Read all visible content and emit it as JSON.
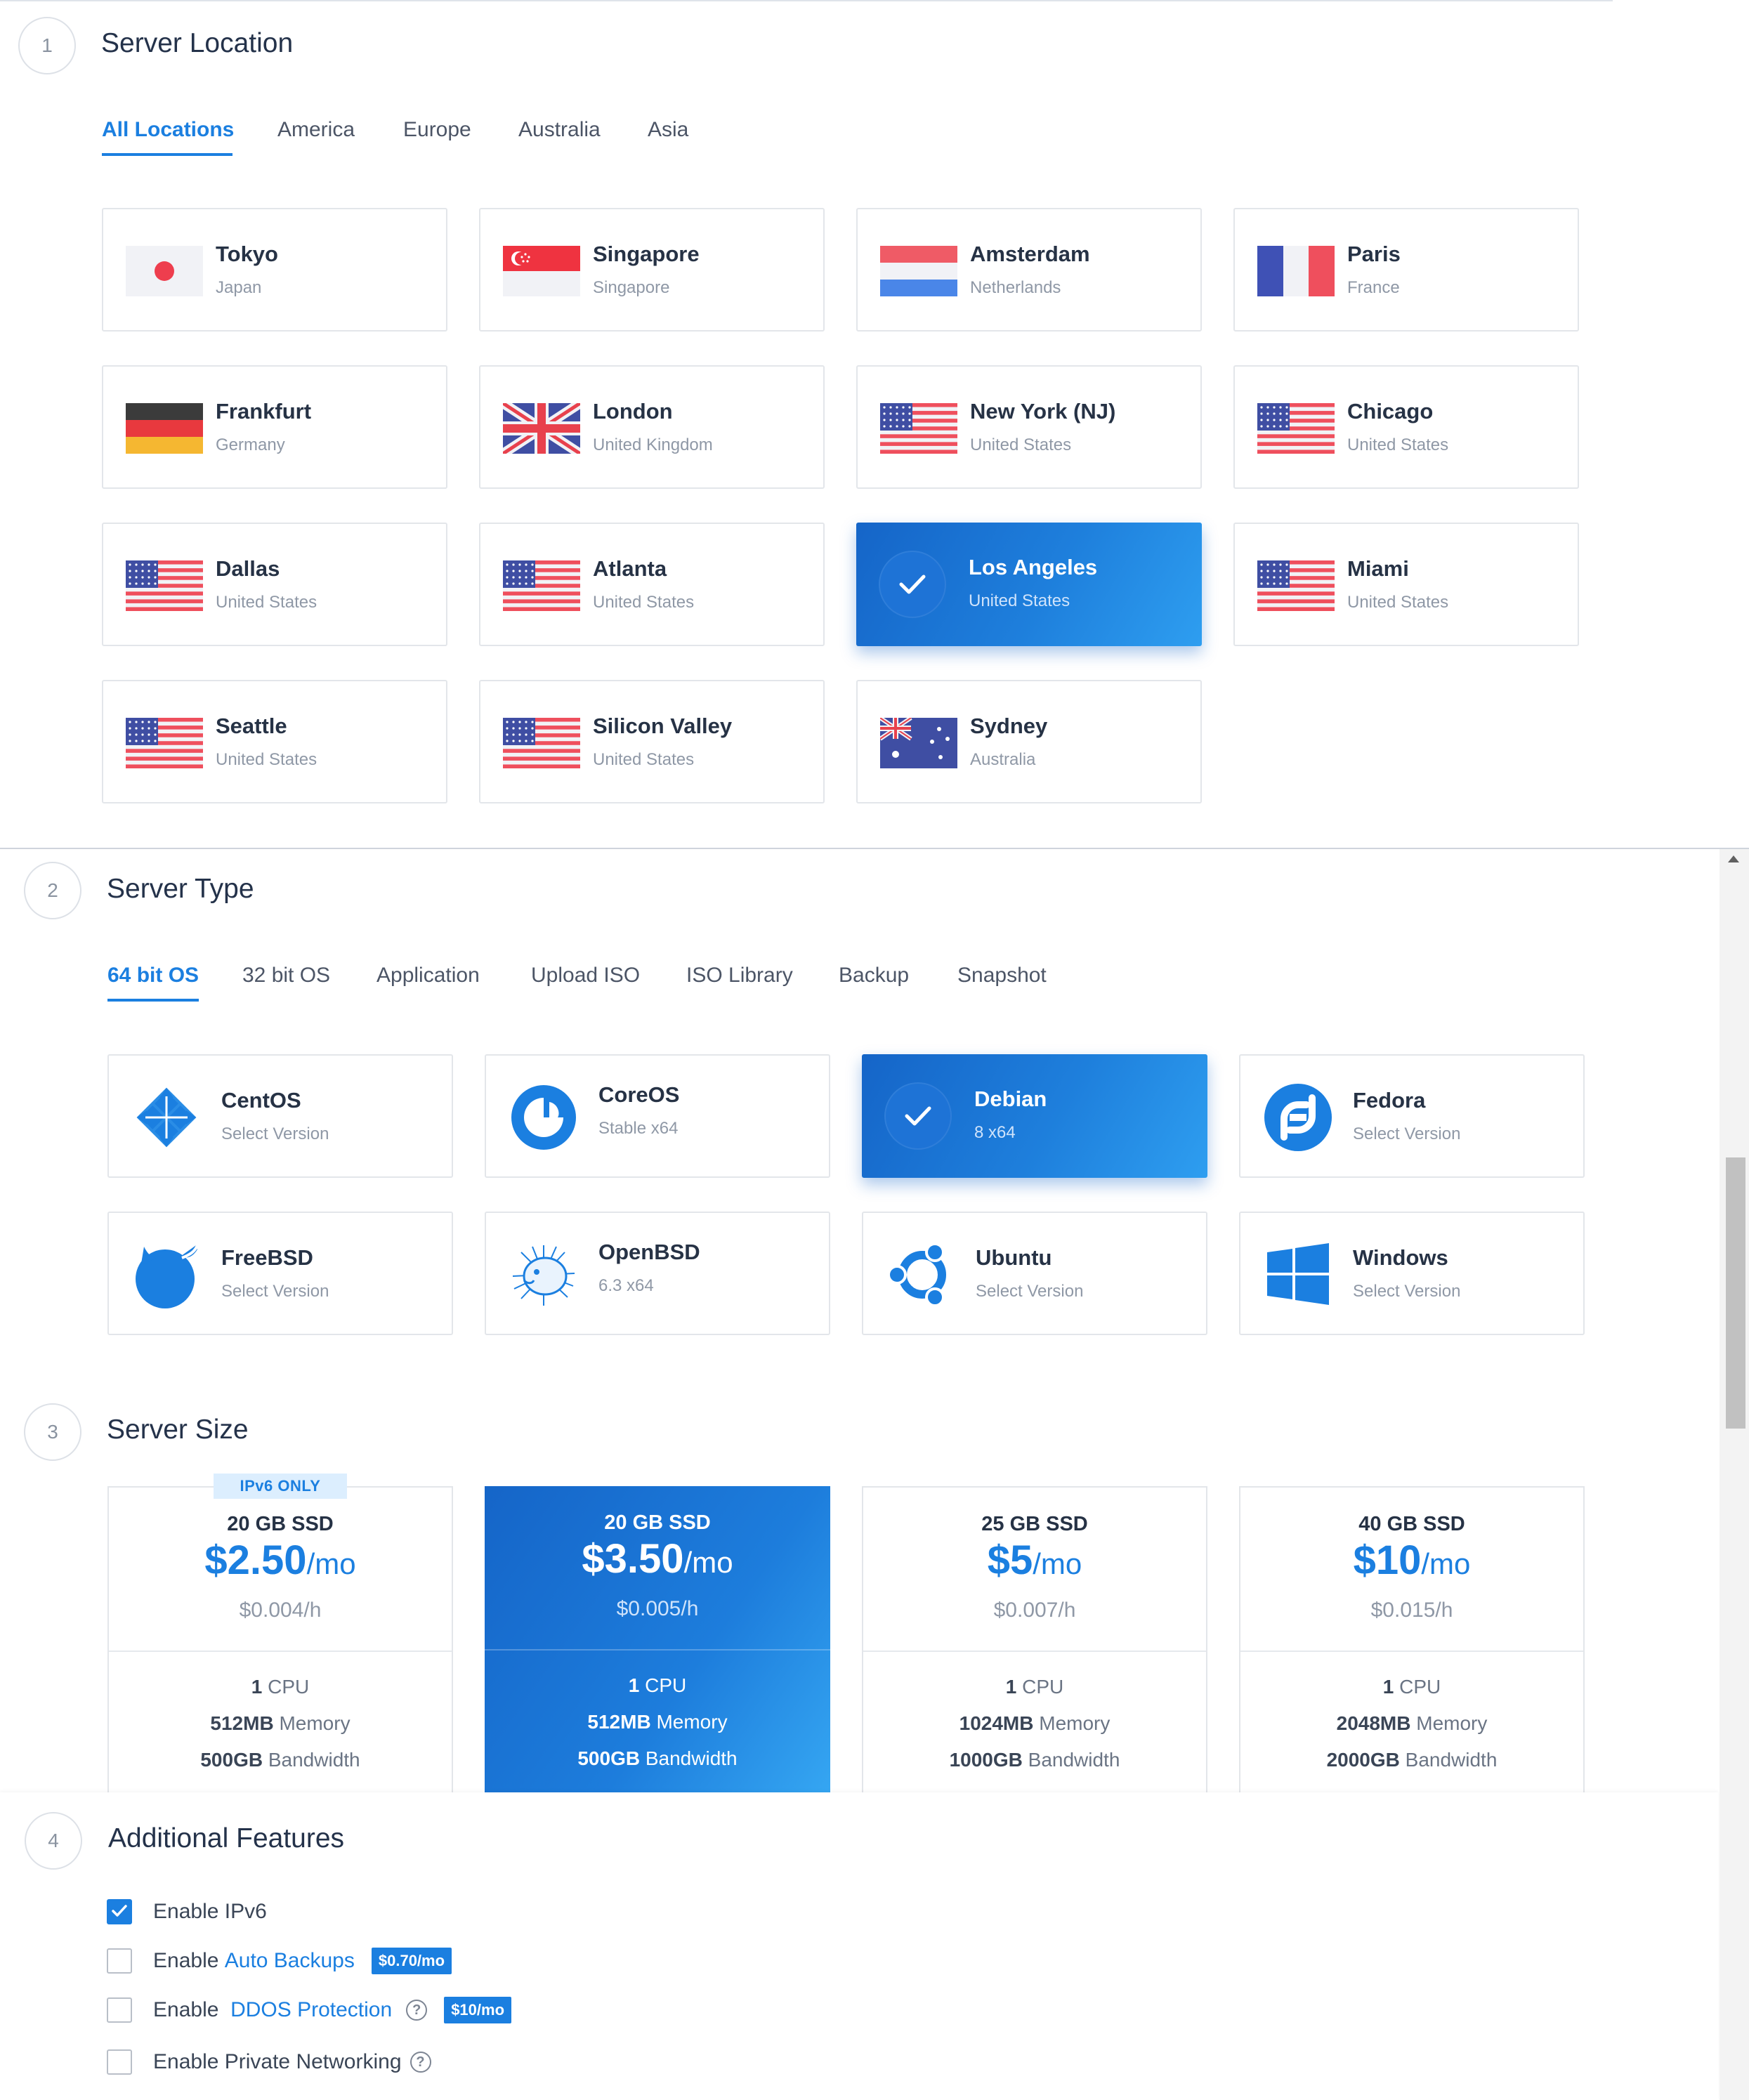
{
  "sections": {
    "location": {
      "step": "1",
      "title": "Server Location",
      "tabs": [
        "All Locations",
        "America",
        "Europe",
        "Australia",
        "Asia"
      ],
      "active_tab": "All Locations",
      "cards": [
        {
          "city": "Tokyo",
          "country": "Japan",
          "flag": "japan-flag"
        },
        {
          "city": "Singapore",
          "country": "Singapore",
          "flag": "singapore-flag"
        },
        {
          "city": "Amsterdam",
          "country": "Netherlands",
          "flag": "netherlands-flag"
        },
        {
          "city": "Paris",
          "country": "France",
          "flag": "france-flag"
        },
        {
          "city": "Frankfurt",
          "country": "Germany",
          "flag": "germany-flag"
        },
        {
          "city": "London",
          "country": "United Kingdom",
          "flag": "uk-flag"
        },
        {
          "city": "New York (NJ)",
          "country": "United States",
          "flag": "us-flag"
        },
        {
          "city": "Chicago",
          "country": "United States",
          "flag": "us-flag"
        },
        {
          "city": "Dallas",
          "country": "United States",
          "flag": "us-flag"
        },
        {
          "city": "Atlanta",
          "country": "United States",
          "flag": "us-flag"
        },
        {
          "city": "Los Angeles",
          "country": "United States",
          "flag": "check-icon",
          "selected": true
        },
        {
          "city": "Miami",
          "country": "United States",
          "flag": "us-flag"
        },
        {
          "city": "Seattle",
          "country": "United States",
          "flag": "us-flag"
        },
        {
          "city": "Silicon Valley",
          "country": "United States",
          "flag": "us-flag"
        },
        {
          "city": "Sydney",
          "country": "Australia",
          "flag": "australia-flag"
        }
      ]
    },
    "type": {
      "step": "2",
      "title": "Server Type",
      "tabs": [
        "64 bit OS",
        "32 bit OS",
        "Application",
        "Upload ISO",
        "ISO Library",
        "Backup",
        "Snapshot"
      ],
      "active_tab": "64 bit OS",
      "cards": [
        {
          "name": "CentOS",
          "version": "Select Version",
          "icon": "centos-icon"
        },
        {
          "name": "CoreOS",
          "version": "Stable  x64",
          "icon": "coreos-icon"
        },
        {
          "name": "Debian",
          "version": "8  x64",
          "icon": "check-icon",
          "selected": true
        },
        {
          "name": "Fedora",
          "version": "Select Version",
          "icon": "fedora-icon"
        },
        {
          "name": "FreeBSD",
          "version": "Select Version",
          "icon": "freebsd-icon"
        },
        {
          "name": "OpenBSD",
          "version": "6.3  x64",
          "icon": "openbsd-icon"
        },
        {
          "name": "Ubuntu",
          "version": "Select Version",
          "icon": "ubuntu-icon"
        },
        {
          "name": "Windows",
          "version": "Select Version",
          "icon": "windows-icon"
        }
      ]
    },
    "size": {
      "step": "3",
      "title": "Server Size",
      "badge": "IPv6 ONLY",
      "plans": [
        {
          "storage": "20 GB SSD",
          "price": "$2.50",
          "period": "/mo",
          "hourly": "$0.004/h",
          "cpu_num": "1",
          "cpu_label": " CPU",
          "memory": "512MB",
          "memory_label": " Memory",
          "bandwidth": "500GB",
          "bandwidth_label": " Bandwidth"
        },
        {
          "storage": "20 GB SSD",
          "price": "$3.50",
          "period": "/mo",
          "hourly": "$0.005/h",
          "cpu_num": "1",
          "cpu_label": " CPU",
          "memory": "512MB",
          "memory_label": " Memory",
          "bandwidth": "500GB",
          "bandwidth_label": " Bandwidth",
          "selected": true
        },
        {
          "storage": "25 GB SSD",
          "price": "$5",
          "period": "/mo",
          "hourly": "$0.007/h",
          "cpu_num": "1",
          "cpu_label": " CPU",
          "memory": "1024MB",
          "memory_label": " Memory",
          "bandwidth": "1000GB",
          "bandwidth_label": " Bandwidth"
        },
        {
          "storage": "40 GB SSD",
          "price": "$10",
          "period": "/mo",
          "hourly": "$0.015/h",
          "cpu_num": "1",
          "cpu_label": " CPU",
          "memory": "2048MB",
          "memory_label": " Memory",
          "bandwidth": "2000GB",
          "bandwidth_label": " Bandwidth"
        }
      ]
    },
    "features": {
      "step": "4",
      "title": "Additional Features",
      "items": [
        {
          "prefix": "Enable IPv6",
          "link": "",
          "checked": true
        },
        {
          "prefix": "Enable ",
          "link": "Auto Backups",
          "badge": "$0.70/mo",
          "checked": false
        },
        {
          "prefix": "Enable  ",
          "link": "DDOS Protection",
          "help": "?",
          "badge": "$10/mo",
          "checked": false
        },
        {
          "prefix": "Enable Private Networking",
          "link": "",
          "help": "?",
          "checked": false
        }
      ]
    }
  },
  "colors": {
    "accent": "#1b7fe0",
    "selected_gradient_start": "#1565c8",
    "selected_gradient_end": "#2e9ef0"
  }
}
